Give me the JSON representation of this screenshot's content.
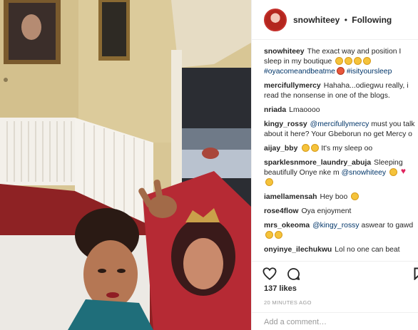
{
  "post": {
    "username": "snowhiteey",
    "separator": "•",
    "follow_status": "Following",
    "likes": "137 likes",
    "timestamp": "20 MINUTES AGO",
    "add_comment_placeholder": "Add a comment…"
  },
  "caption": {
    "user": "snowhiteey",
    "text": "The exact way and position I sleep in my boutique",
    "hashtags": [
      "#oyacomeandbeatme",
      "#isityoursleep"
    ]
  },
  "comments": [
    {
      "user": "mercifullymercy",
      "text": "Hahaha...odiegwu really, i read the nonsense in one of the blogs."
    },
    {
      "user": "nriada",
      "text": "Lmaoooo"
    },
    {
      "user": "kingy_rossy",
      "mention": "@mercifullymercy",
      "text": "must you talk about it here? Your Gbeborun no get Mercy o"
    },
    {
      "user": "aijay_bby",
      "text": "It's my sleep oo"
    },
    {
      "user": "sparklesnmore_laundry_abuja",
      "text": "Sleeping beautifully Onye nke m",
      "mention": "@snowhiteey"
    },
    {
      "user": "iamellamensah",
      "text": "Hey boo"
    },
    {
      "user": "rose4flow",
      "text": "Oya enjoyment"
    },
    {
      "user": "mrs_okeoma",
      "mention": "@kingy_rossy",
      "text": "aswear to gawd"
    },
    {
      "user": "onyinye_ilechukwu",
      "text": "Lol no one can beat"
    }
  ],
  "icons": {
    "like": "heart-outline-icon",
    "comment": "comment-bubble-icon",
    "save": "bookmark-icon"
  },
  "colors": {
    "link": "#003569",
    "text": "#262626",
    "muted": "#999999",
    "avatar_ring": "#c4302b"
  }
}
